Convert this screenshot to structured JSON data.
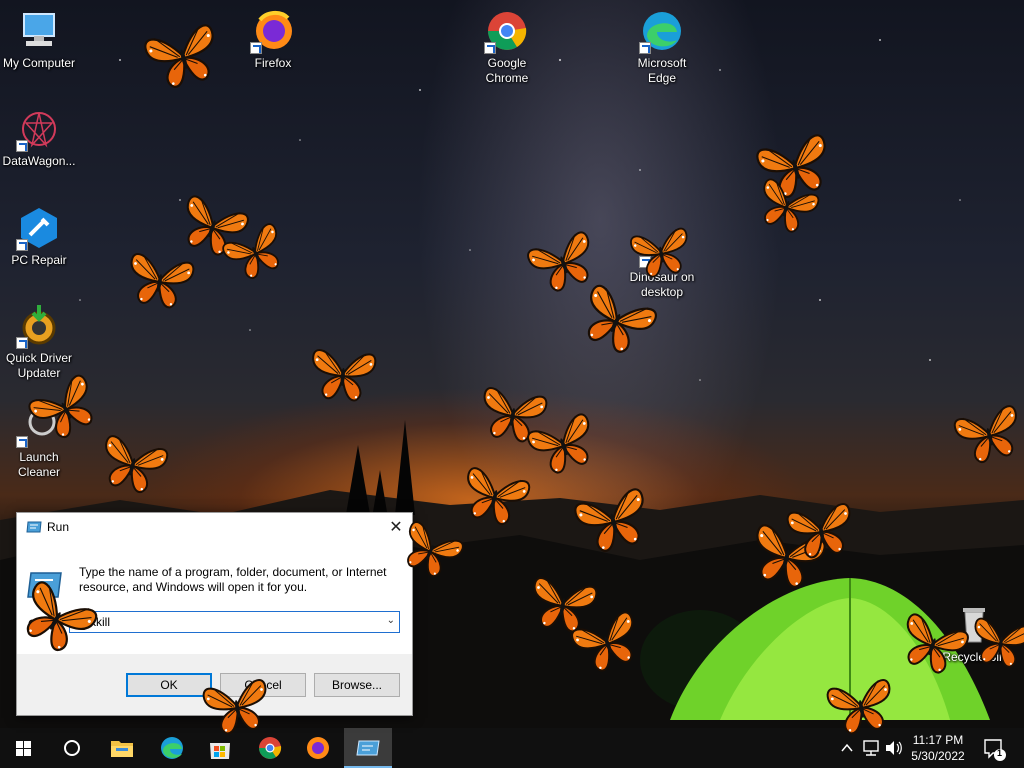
{
  "desktop": {
    "icons": [
      {
        "label": "My Computer"
      },
      {
        "label": "DataWagon..."
      },
      {
        "label": "PC Repair"
      },
      {
        "label": "Quick Driver Updater"
      },
      {
        "label": "Launch Cleaner"
      },
      {
        "label": "Firefox"
      },
      {
        "label": "Google Chrome"
      },
      {
        "label": "Microsoft Edge"
      },
      {
        "label": "Dinosaur on desktop"
      },
      {
        "label": "Recycle Bin"
      }
    ]
  },
  "run_dialog": {
    "title": "Run",
    "description": "Type the name of a program, folder, document, or Internet resource, and Windows will open it for you.",
    "open_label": "Open:",
    "open_value": "taskkill",
    "ok_label": "OK",
    "cancel_label": "Cancel",
    "browse_label": "Browse..."
  },
  "taskbar": {
    "items": [
      "start-icon",
      "cortana-icon",
      "file-explorer-icon",
      "edge-icon",
      "store-icon",
      "chrome-icon",
      "firefox-icon",
      "run-icon"
    ],
    "clock_time": "11:17 PM",
    "clock_date": "5/30/2022",
    "notification_count": "1"
  },
  "colors": {
    "taskbar_bg": "#101010",
    "accent": "#0078d7",
    "butterfly_orange": "#f07a10"
  }
}
